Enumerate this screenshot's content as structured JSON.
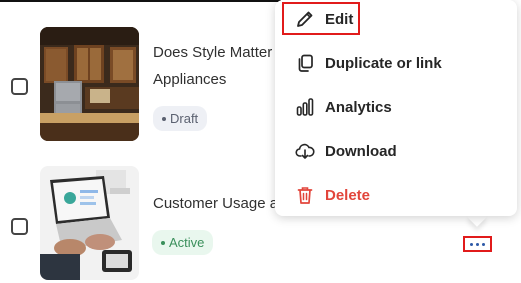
{
  "items": [
    {
      "title_line1": "Does Style Matter",
      "title_line2": "Appliances",
      "status": "Draft",
      "status_color": "#5b6170",
      "status_bg": "#eef0f5"
    },
    {
      "title_line1": "Customer Usage a",
      "status": "Active",
      "status_color": "#3a8f5b",
      "status_bg": "#e9f7ee"
    }
  ],
  "menu": {
    "items": [
      {
        "label": "Edit",
        "icon": "pencil-icon"
      },
      {
        "label": "Duplicate or link",
        "icon": "duplicate-icon"
      },
      {
        "label": "Analytics",
        "icon": "analytics-icon"
      },
      {
        "label": "Download",
        "icon": "cloud-download-icon"
      },
      {
        "label": "Delete",
        "icon": "trash-icon"
      }
    ]
  },
  "colors": {
    "highlight": "#e11b1b",
    "delete": "#e2453b",
    "more_dots": "#2e5aa8"
  }
}
